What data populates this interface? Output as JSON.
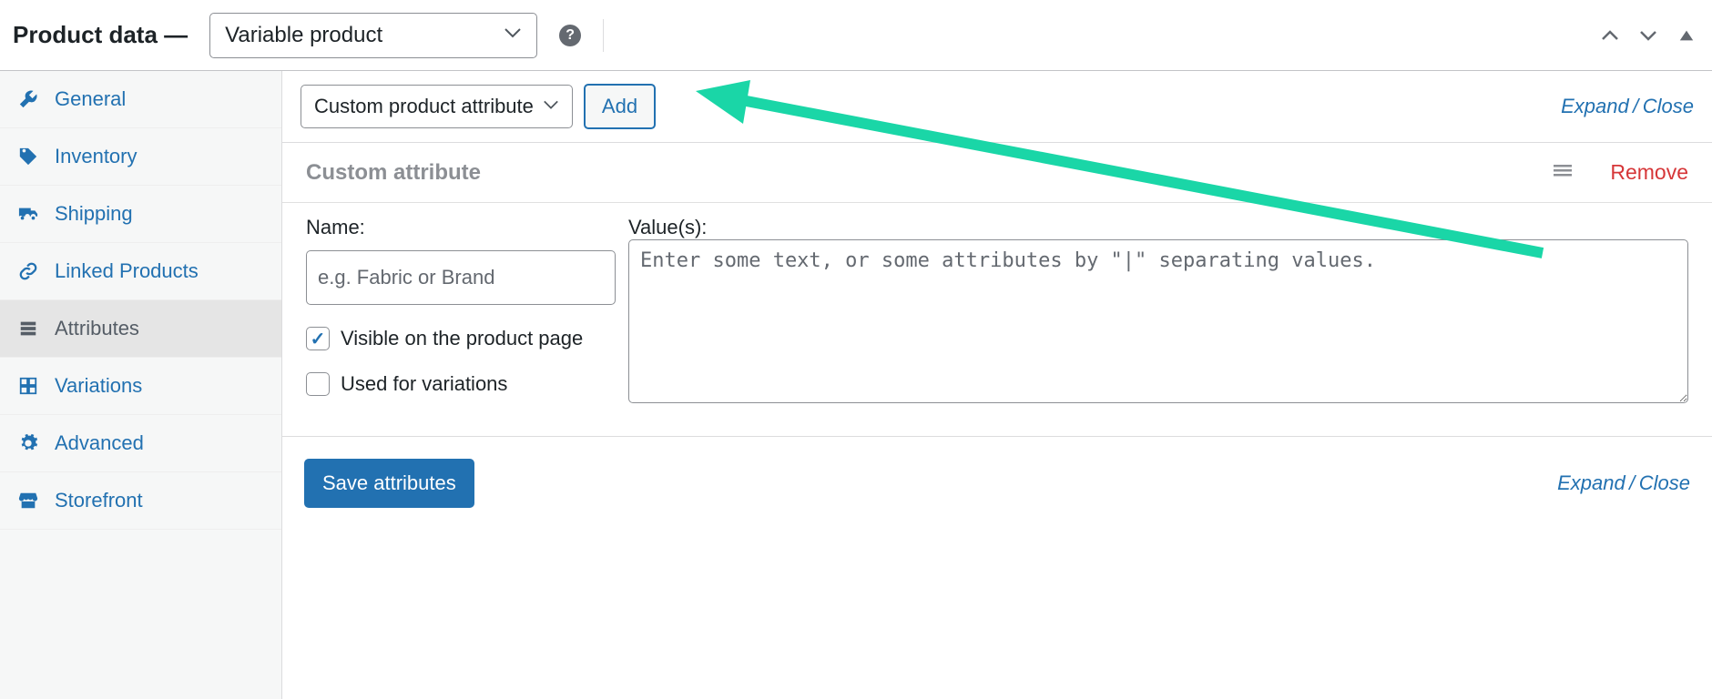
{
  "header": {
    "title": "Product data —",
    "product_type": "Variable product"
  },
  "sidebar": {
    "items": [
      {
        "label": "General"
      },
      {
        "label": "Inventory"
      },
      {
        "label": "Shipping"
      },
      {
        "label": "Linked Products"
      },
      {
        "label": "Attributes"
      },
      {
        "label": "Variations"
      },
      {
        "label": "Advanced"
      },
      {
        "label": "Storefront"
      }
    ]
  },
  "toolbar": {
    "attribute_type": "Custom product attribute",
    "add_label": "Add",
    "expand_label": "Expand",
    "close_label": "Close",
    "separator": "/"
  },
  "attribute": {
    "header_title": "Custom attribute",
    "remove_label": "Remove",
    "name_label": "Name:",
    "name_placeholder": "e.g. Fabric or Brand",
    "values_label": "Value(s):",
    "values_placeholder": "Enter some text, or some attributes by \"|\" separating values.",
    "visible_label": "Visible on the product page",
    "used_label": "Used for variations",
    "visible_checked": true,
    "used_checked": false
  },
  "bottom": {
    "save_label": "Save attributes",
    "expand_label": "Expand",
    "close_label": "Close",
    "separator": "/"
  }
}
